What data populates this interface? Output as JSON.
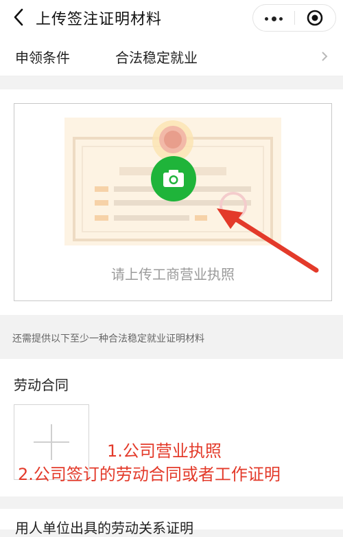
{
  "nav": {
    "title": "上传签注证明材料",
    "back_icon": "chevron-left-icon",
    "menu_icon": "more-dots-icon",
    "close_icon": "target-close-icon"
  },
  "condition": {
    "label": "申领条件",
    "value": "合法稳定就业",
    "arrow_icon": "chevron-right-icon"
  },
  "upload": {
    "prompt": "请上传工商营业执照",
    "camera_icon": "camera-icon",
    "colors": {
      "camera_bg": "#1fb43a",
      "license_bg": "#fdf3e3",
      "arrow": "#e33a2a"
    }
  },
  "hint": "还需提供以下至少一种合法稳定就业证明材料",
  "contract": {
    "title": "劳动合同",
    "add_icon": "plus-icon",
    "annotation_line1": "1.公司营业执照",
    "annotation_line2": "2.公司签订的劳动合同或者工作证明"
  },
  "next_section": {
    "title": "用人单位出具的劳动关系证明"
  }
}
